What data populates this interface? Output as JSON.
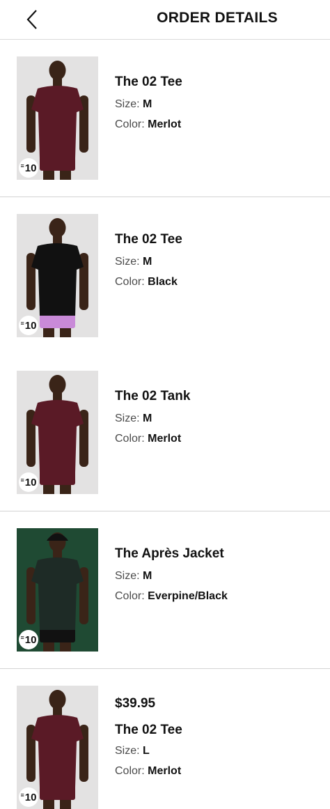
{
  "header": {
    "title": "ORDER DETAILS"
  },
  "badge_text": "10",
  "size_label": "Size:",
  "color_label": "Color:",
  "items": [
    {
      "name": "The 02 Tee",
      "size": "M",
      "color": "Merlot",
      "shirt_color": "#5a1a26",
      "bottom_color": "#5a1a26",
      "bg_color": "#e3e2e2",
      "headwear": false
    },
    {
      "name": "The 02 Tee",
      "size": "M",
      "color": "Black",
      "shirt_color": "#111111",
      "bottom_color": "#c98ad8",
      "bg_color": "#e3e2e2",
      "headwear": false
    },
    {
      "name": "The 02 Tank",
      "size": "M",
      "color": "Merlot",
      "shirt_color": "#5a1a26",
      "bottom_color": "#5a1a26",
      "bg_color": "#e3e2e2",
      "headwear": false
    },
    {
      "name": "The Après Jacket",
      "size": "M",
      "color": "Everpine/Black",
      "shirt_color": "#1e2b26",
      "bottom_color": "#111111",
      "bg_color": "#1f4a33",
      "headwear": true
    },
    {
      "name": "The 02 Tee",
      "size": "L",
      "color": "Merlot",
      "price": "$39.95",
      "shirt_color": "#5a1a26",
      "bottom_color": "#5a1a26",
      "bg_color": "#e3e2e2",
      "headwear": false
    }
  ]
}
